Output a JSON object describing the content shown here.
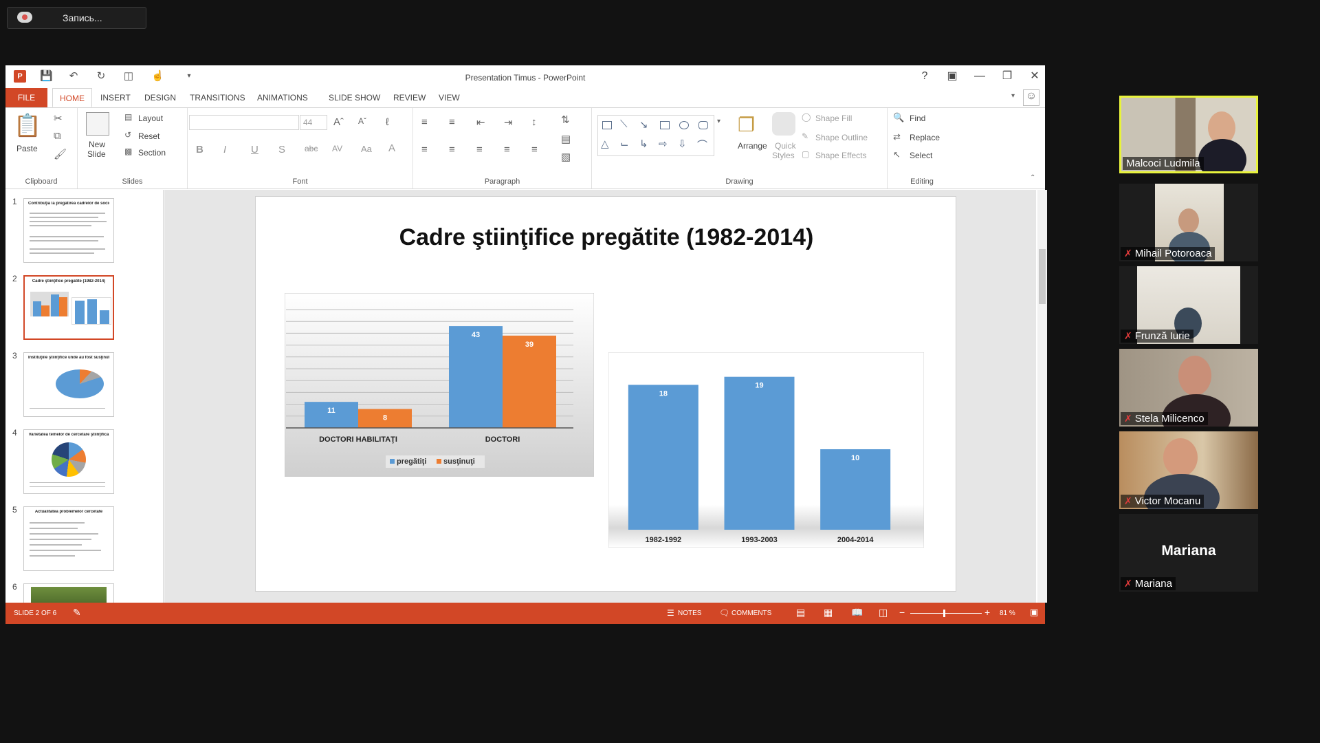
{
  "recording": {
    "label": "Запись..."
  },
  "window": {
    "title": "Presentation Timus - PowerPoint"
  },
  "tabs": [
    "FILE",
    "HOME",
    "INSERT",
    "DESIGN",
    "TRANSITIONS",
    "ANIMATIONS",
    "SLIDE SHOW",
    "REVIEW",
    "VIEW"
  ],
  "ribbon": {
    "clipboard": {
      "paste": "Paste",
      "group": "Clipboard"
    },
    "slides": {
      "new_slide": "New",
      "new_slide2": "Slide",
      "layout": "Layout",
      "reset": "Reset",
      "section": "Section",
      "group": "Slides"
    },
    "font": {
      "size": "44",
      "group": "Font"
    },
    "paragraph": {
      "group": "Paragraph"
    },
    "drawing": {
      "arrange": "Arrange",
      "quick_styles": "Quick",
      "quick_styles2": "Styles",
      "shape_fill": "Shape Fill",
      "shape_outline": "Shape Outline",
      "shape_effects": "Shape Effects",
      "group": "Drawing"
    },
    "editing": {
      "find": "Find",
      "replace": "Replace",
      "select": "Select",
      "group": "Editing"
    }
  },
  "thumbnails": [
    {
      "num": "1",
      "title": "Contribuţia la pregătirea cadrelor de sociologi"
    },
    {
      "num": "2",
      "title": "Cadre ştiinţifice pregătite (1982-2014)"
    },
    {
      "num": "3",
      "title": "Instituţiile ştiinţifice unde au fost susţinute tezele de doctor/doctor habilitat"
    },
    {
      "num": "4",
      "title": "Varietatea temelor de cercetare ştiinţifică"
    },
    {
      "num": "5",
      "title": "Actualitatea problemelor cercetate"
    },
    {
      "num": "6",
      "title": ""
    }
  ],
  "slide": {
    "title": "Cadre ştiinţifice pregătite  (1982-2014)"
  },
  "chart_data": [
    {
      "type": "bar",
      "categories": [
        "DOCTORI HABILITAŢI",
        "DOCTORI"
      ],
      "series": [
        {
          "name": "pregătiţi",
          "values": [
            11,
            43
          ],
          "color": "#5b9bd5"
        },
        {
          "name": "susţinuţi",
          "values": [
            8,
            39
          ],
          "color": "#ed7d31"
        }
      ],
      "ylim": [
        0,
        50
      ],
      "grid": true,
      "legend": "bottom"
    },
    {
      "type": "bar",
      "categories": [
        "1982-1992",
        "1993-2003",
        "2004-2014"
      ],
      "values": [
        18,
        19,
        10
      ],
      "color": "#5b9bd5",
      "ylim": [
        0,
        20
      ],
      "grid": false
    }
  ],
  "status": {
    "slide": "SLIDE 2 OF 6",
    "notes": "NOTES",
    "comments": "COMMENTS",
    "zoom": "81 %"
  },
  "participants": [
    {
      "name": "Malcoci Ludmila",
      "muted": false,
      "active": true
    },
    {
      "name": "Mihail Potoroaca",
      "muted": true
    },
    {
      "name": "Frunză Iurie",
      "muted": true
    },
    {
      "name": "Stela Milicenco",
      "muted": true
    },
    {
      "name": "Victor  Mocanu",
      "muted": true
    },
    {
      "name": "Mariana",
      "muted": true,
      "big_name": "Mariana"
    }
  ]
}
